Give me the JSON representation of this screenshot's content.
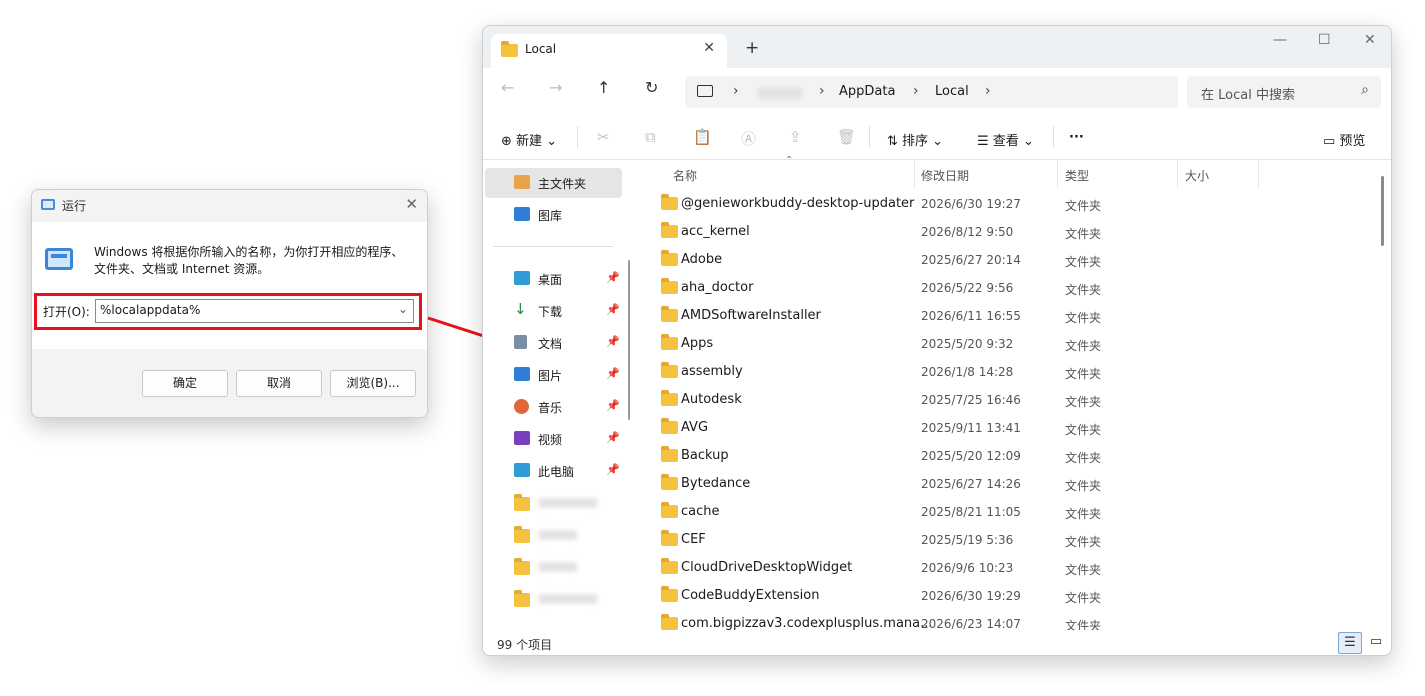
{
  "run_dialog": {
    "title": "运行",
    "description": "Windows 将根据你所输入的名称，为你打开相应的程序、文件夹、文档或 Internet 资源。",
    "open_label": "打开(O):",
    "open_value": "%localappdata%",
    "ok_label": "确定",
    "cancel_label": "取消",
    "browse_label": "浏览(B)..."
  },
  "explorer": {
    "tab_title": "Local",
    "breadcrumb": [
      "AppData",
      "Local"
    ],
    "search_placeholder": "在 Local 中搜索",
    "toolbar": {
      "new_label": "新建",
      "sort_label": "排序",
      "view_label": "查看",
      "more_label": "···",
      "preview_label": "预览"
    },
    "sidebar": {
      "home": "主文件夹",
      "gallery": "图库",
      "pinned": [
        {
          "label": "桌面",
          "icon": "desktop-icon",
          "color": "#2f9bd8"
        },
        {
          "label": "下载",
          "icon": "download-icon",
          "color": "#1f8a4c"
        },
        {
          "label": "文档",
          "icon": "document-icon",
          "color": "#7a8fa6"
        },
        {
          "label": "图片",
          "icon": "picture-icon",
          "color": "#2f7fd8"
        },
        {
          "label": "音乐",
          "icon": "music-icon",
          "color": "#e0663a"
        },
        {
          "label": "视频",
          "icon": "video-icon",
          "color": "#7a3fbf"
        },
        {
          "label": "此电脑",
          "icon": "computer-icon",
          "color": "#2f9bd8"
        }
      ]
    },
    "columns": [
      "名称",
      "修改日期",
      "类型",
      "大小"
    ],
    "files": [
      {
        "name": "@genieworkbuddy-desktop-updater",
        "date": "2026/6/30 19:27",
        "type": "文件夹"
      },
      {
        "name": "acc_kernel",
        "date": "2026/8/12 9:50",
        "type": "文件夹"
      },
      {
        "name": "Adobe",
        "date": "2025/6/27 20:14",
        "type": "文件夹"
      },
      {
        "name": "aha_doctor",
        "date": "2026/5/22 9:56",
        "type": "文件夹"
      },
      {
        "name": "AMDSoftwareInstaller",
        "date": "2026/6/11 16:55",
        "type": "文件夹"
      },
      {
        "name": "Apps",
        "date": "2025/5/20 9:32",
        "type": "文件夹"
      },
      {
        "name": "assembly",
        "date": "2026/1/8 14:28",
        "type": "文件夹"
      },
      {
        "name": "Autodesk",
        "date": "2025/7/25 16:46",
        "type": "文件夹"
      },
      {
        "name": "AVG",
        "date": "2025/9/11 13:41",
        "type": "文件夹"
      },
      {
        "name": "Backup",
        "date": "2025/5/20 12:09",
        "type": "文件夹"
      },
      {
        "name": "Bytedance",
        "date": "2025/6/27 14:26",
        "type": "文件夹"
      },
      {
        "name": "cache",
        "date": "2025/8/21 11:05",
        "type": "文件夹"
      },
      {
        "name": "CEF",
        "date": "2025/5/19 5:36",
        "type": "文件夹"
      },
      {
        "name": "CloudDriveDesktopWidget",
        "date": "2026/9/6 10:23",
        "type": "文件夹"
      },
      {
        "name": "CodeBuddyExtension",
        "date": "2026/6/30 19:29",
        "type": "文件夹"
      },
      {
        "name": "com.bigpizzav3.codexplusplus.mana...",
        "date": "2026/6/23 14:07",
        "type": "文件夹"
      }
    ],
    "status_count": "99 个项目"
  }
}
